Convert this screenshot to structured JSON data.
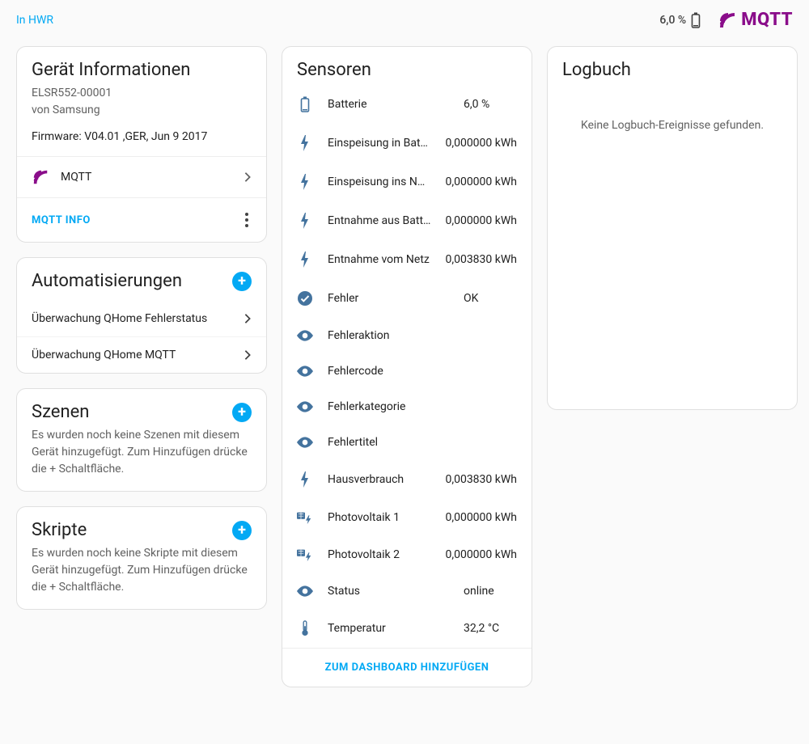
{
  "breadcrumb": "In HWR",
  "battery_percent": "6,0 %",
  "mqtt_label": "MQTT",
  "device_info": {
    "title": "Gerät Informationen",
    "model": "ELSR552-00001",
    "vendor": "von Samsung",
    "firmware": "Firmware: V04.01 ,GER, Jun 9 2017",
    "integration_label": "MQTT",
    "mqtt_info_btn": "MQTT INFO"
  },
  "automations": {
    "title": "Automatisierungen",
    "items": [
      "Überwachung QHome Fehlerstatus",
      "Überwachung QHome MQTT"
    ]
  },
  "scenes": {
    "title": "Szenen",
    "empty": "Es wurden noch keine Szenen mit diesem Gerät hinzugefügt. Zum Hinzufügen drücke die + Schaltfläche."
  },
  "scripts": {
    "title": "Skripte",
    "empty": "Es wurden noch keine Skripte mit diesem Gerät hinzugefügt. Zum Hinzufügen drücke die + Schaltfläche."
  },
  "sensors": {
    "title": "Sensoren",
    "items": [
      {
        "icon": "battery",
        "name": "Batterie",
        "value": "6,0 %"
      },
      {
        "icon": "flash",
        "name": "Einspeisung in Batte…",
        "value": "0,000000 kWh"
      },
      {
        "icon": "flash",
        "name": "Einspeisung ins Netz",
        "value": "0,000000 kWh"
      },
      {
        "icon": "flash",
        "name": "Entnahme aus Batte…",
        "value": "0,000000 kWh"
      },
      {
        "icon": "flash",
        "name": "Entnahme vom Netz",
        "value": "0,003830 kWh"
      },
      {
        "icon": "check",
        "name": "Fehler",
        "value": "OK"
      },
      {
        "icon": "eye",
        "name": "Fehleraktion",
        "value": ""
      },
      {
        "icon": "eye",
        "name": "Fehlercode",
        "value": ""
      },
      {
        "icon": "eye",
        "name": "Fehlerkategorie",
        "value": ""
      },
      {
        "icon": "eye",
        "name": "Fehlertitel",
        "value": ""
      },
      {
        "icon": "flash",
        "name": "Hausverbrauch",
        "value": "0,003830 kWh"
      },
      {
        "icon": "solar",
        "name": "Photovoltaik 1",
        "value": "0,000000 kWh"
      },
      {
        "icon": "solar",
        "name": "Photovoltaik 2",
        "value": "0,000000 kWh"
      },
      {
        "icon": "eye",
        "name": "Status",
        "value": "online"
      },
      {
        "icon": "temp",
        "name": "Temperatur",
        "value": "32,2 °C"
      }
    ],
    "dashboard_btn": "ZUM DASHBOARD HINZUFÜGEN"
  },
  "logbook": {
    "title": "Logbuch",
    "empty": "Keine Logbuch-Ereignisse gefunden."
  }
}
